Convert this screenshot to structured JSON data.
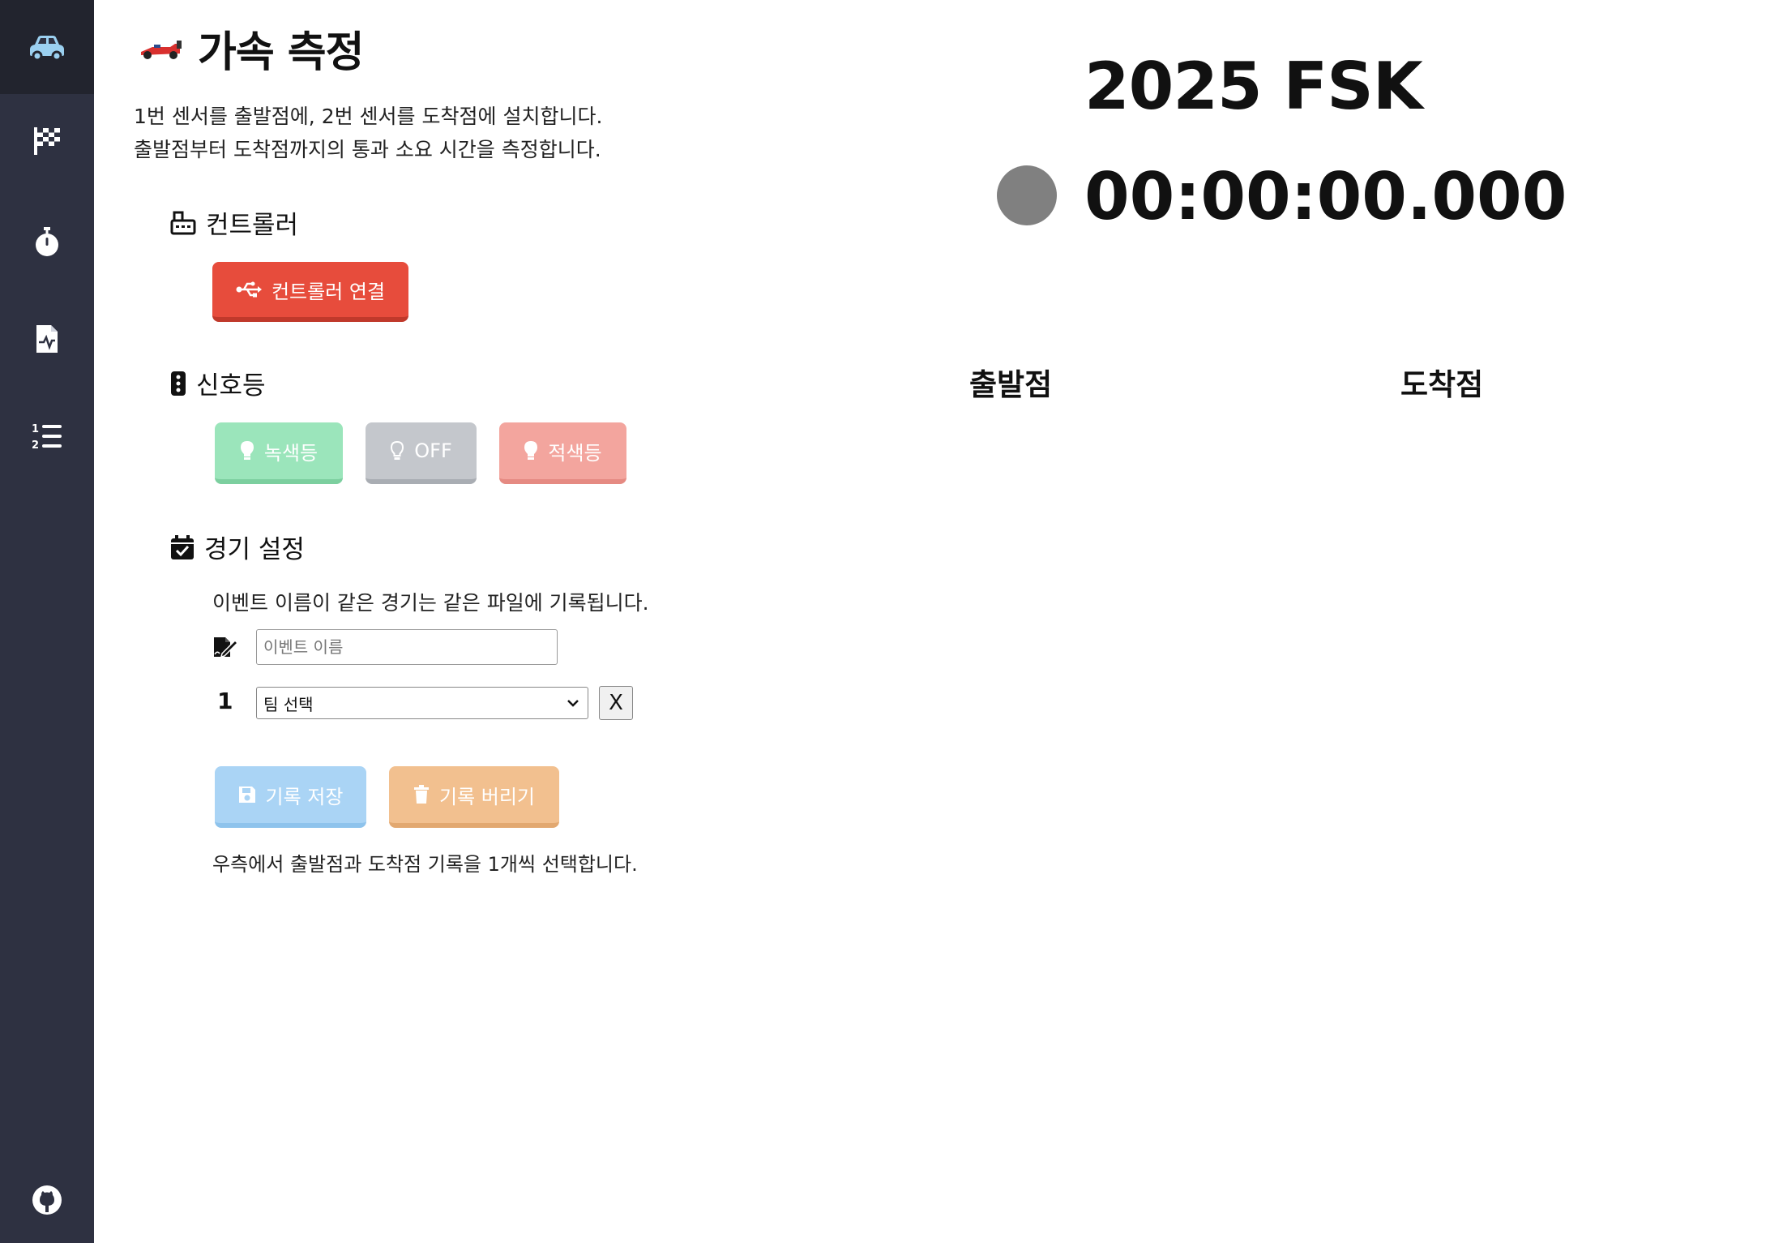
{
  "sidebar": {
    "items": [
      {
        "icon": "car-icon"
      },
      {
        "icon": "checkered-flag-icon"
      },
      {
        "icon": "stopwatch-icon"
      },
      {
        "icon": "file-waveform-icon"
      },
      {
        "icon": "numbered-list-icon"
      }
    ],
    "footer_icon": "github-icon"
  },
  "page": {
    "title": "가속 측정",
    "title_icon": "race-car-icon",
    "desc_line1": "1번 센서를 출발점에, 2번 센서를 도착점에 설치합니다.",
    "desc_line2": "출발점부터 도착점까지의 통과 소요 시간을 측정합니다."
  },
  "controller": {
    "heading": "컨트롤러",
    "heading_icon": "keyboard-icon",
    "connect_label": "컨트롤러 연결",
    "connect_icon": "usb-icon",
    "connect_color": "#e74c3c"
  },
  "signal": {
    "heading": "신호등",
    "heading_icon": "traffic-light-icon",
    "green_label": "녹색등",
    "off_label": "OFF",
    "red_label": "적색등",
    "green_color": "#9be5bb",
    "off_color": "#c4c7cc",
    "red_color": "#f3a59e"
  },
  "match": {
    "heading": "경기 설정",
    "heading_icon": "calendar-check-icon",
    "note": "이벤트 이름이 같은 경기는 같은 파일에 기록됩니다.",
    "event_placeholder": "이벤트 이름",
    "event_value": "",
    "team_index": "1",
    "team_select": "팀 선택",
    "clear_label": "X",
    "save_label": "기록 저장",
    "discard_label": "기록 버리기",
    "save_color": "#aad4f5",
    "discard_color": "#f2c08f",
    "footer_note": "우측에서 출발점과 도착점 기록을 1개씩 선택합니다."
  },
  "display": {
    "event_title": "2025 FSK",
    "timer": "00:00:00.000",
    "status_color": "#808080",
    "start_heading": "출발점",
    "finish_heading": "도착점"
  }
}
